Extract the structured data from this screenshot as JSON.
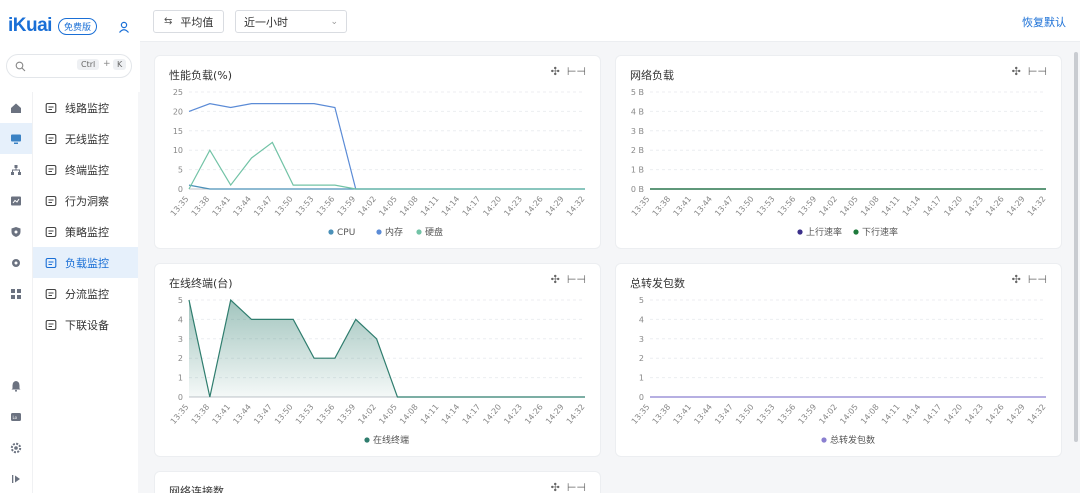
{
  "brand": {
    "logo": "iKuai",
    "edition": "免费版"
  },
  "search": {
    "placeholder": "",
    "key1": "Ctrl",
    "plus": "+",
    "key2": "K"
  },
  "rail_icons": [
    "home-icon",
    "monitor-icon",
    "topology-icon",
    "chart-window-icon",
    "shield-icon",
    "gear-icon",
    "apps-icon"
  ],
  "rail_bottom_icons": [
    "bell-icon",
    "live-icon",
    "settings-icon",
    "collapse-icon"
  ],
  "menu": [
    {
      "label": "线路监控",
      "icon": "route-icon",
      "active": false
    },
    {
      "label": "无线监控",
      "icon": "wireless-icon",
      "active": false
    },
    {
      "label": "终端监控",
      "icon": "terminal-icon",
      "active": false
    },
    {
      "label": "行为洞察",
      "icon": "insight-icon",
      "active": false
    },
    {
      "label": "策略监控",
      "icon": "policy-icon",
      "active": false
    },
    {
      "label": "负载监控",
      "icon": "gauge-icon",
      "active": true
    },
    {
      "label": "分流监控",
      "icon": "split-icon",
      "active": false
    },
    {
      "label": "下联设备",
      "icon": "device-icon",
      "active": false
    }
  ],
  "toolbar": {
    "avg_label": "平均值",
    "range_value": "近一小时",
    "reset_label": "恢复默认"
  },
  "times": [
    "13:35",
    "13:38",
    "13:41",
    "13:44",
    "13:47",
    "13:50",
    "13:53",
    "13:56",
    "13:59",
    "14:02",
    "14:05",
    "14:08",
    "14:11",
    "14:14",
    "14:17",
    "14:20",
    "14:23",
    "14:26",
    "14:29",
    "14:32"
  ],
  "colors": {
    "accent": "#1a6fd6",
    "cpu": "#4a90b8",
    "mem": "#5b8bd6",
    "disk": "#72c3a6",
    "online": "#2f7d6e",
    "up": "#3b2f8a",
    "down": "#1e7a3c",
    "fwd": "#8a7fd0"
  },
  "cards": {
    "perf": {
      "title": "性能负载(%)"
    },
    "net": {
      "title": "网络负载"
    },
    "online": {
      "title": "在线终端(台)"
    },
    "fwd": {
      "title": "总转发包数"
    },
    "conn": {
      "title": "网络连接数"
    }
  },
  "chart_data": [
    {
      "type": "line",
      "title": "性能负载(%)",
      "ylim": [
        0,
        25
      ],
      "yticks": [
        "0",
        "5",
        "10",
        "15",
        "20",
        "25"
      ],
      "series": [
        {
          "name": "CPU",
          "values": [
            1,
            0,
            0,
            0,
            0,
            0,
            0,
            0,
            0,
            0,
            0,
            0,
            0,
            0,
            0,
            0,
            0,
            0,
            0,
            0
          ]
        },
        {
          "name": "内存",
          "values": [
            20,
            22,
            21,
            22,
            22,
            22,
            22,
            21,
            0,
            0,
            0,
            0,
            0,
            0,
            0,
            0,
            0,
            0,
            0,
            0
          ]
        },
        {
          "name": "硬盘",
          "values": [
            0,
            10,
            1,
            8,
            12,
            1,
            1,
            1,
            0,
            0,
            0,
            0,
            0,
            0,
            0,
            0,
            0,
            0,
            0,
            0
          ]
        }
      ]
    },
    {
      "type": "line",
      "title": "网络负载",
      "ylim": [
        0,
        5
      ],
      "yticks": [
        "0 B",
        "1 B",
        "2 B",
        "3 B",
        "4 B",
        "5 B"
      ],
      "series": [
        {
          "name": "上行速率",
          "values": [
            0,
            0,
            0,
            0,
            0,
            0,
            0,
            0,
            0,
            0,
            0,
            0,
            0,
            0,
            0,
            0,
            0,
            0,
            0,
            0
          ]
        },
        {
          "name": "下行速率",
          "values": [
            0,
            0,
            0,
            0,
            0,
            0,
            0,
            0,
            0,
            0,
            0,
            0,
            0,
            0,
            0,
            0,
            0,
            0,
            0,
            0
          ]
        }
      ]
    },
    {
      "type": "area",
      "title": "在线终端(台)",
      "ylim": [
        0,
        5
      ],
      "yticks": [
        "0",
        "1",
        "2",
        "3",
        "4",
        "5"
      ],
      "series": [
        {
          "name": "在线终端",
          "values": [
            5,
            0,
            5,
            4,
            4,
            4,
            2,
            2,
            4,
            3,
            0,
            0,
            0,
            0,
            0,
            0,
            0,
            0,
            0,
            0
          ]
        }
      ]
    },
    {
      "type": "line",
      "title": "总转发包数",
      "ylim": [
        0,
        5
      ],
      "yticks": [
        "0",
        "1",
        "2",
        "3",
        "4",
        "5"
      ],
      "series": [
        {
          "name": "总转发包数",
          "values": [
            0,
            0,
            0,
            0,
            0,
            0,
            0,
            0,
            0,
            0,
            0,
            0,
            0,
            0,
            0,
            0,
            0,
            0,
            0,
            0
          ]
        }
      ]
    }
  ]
}
